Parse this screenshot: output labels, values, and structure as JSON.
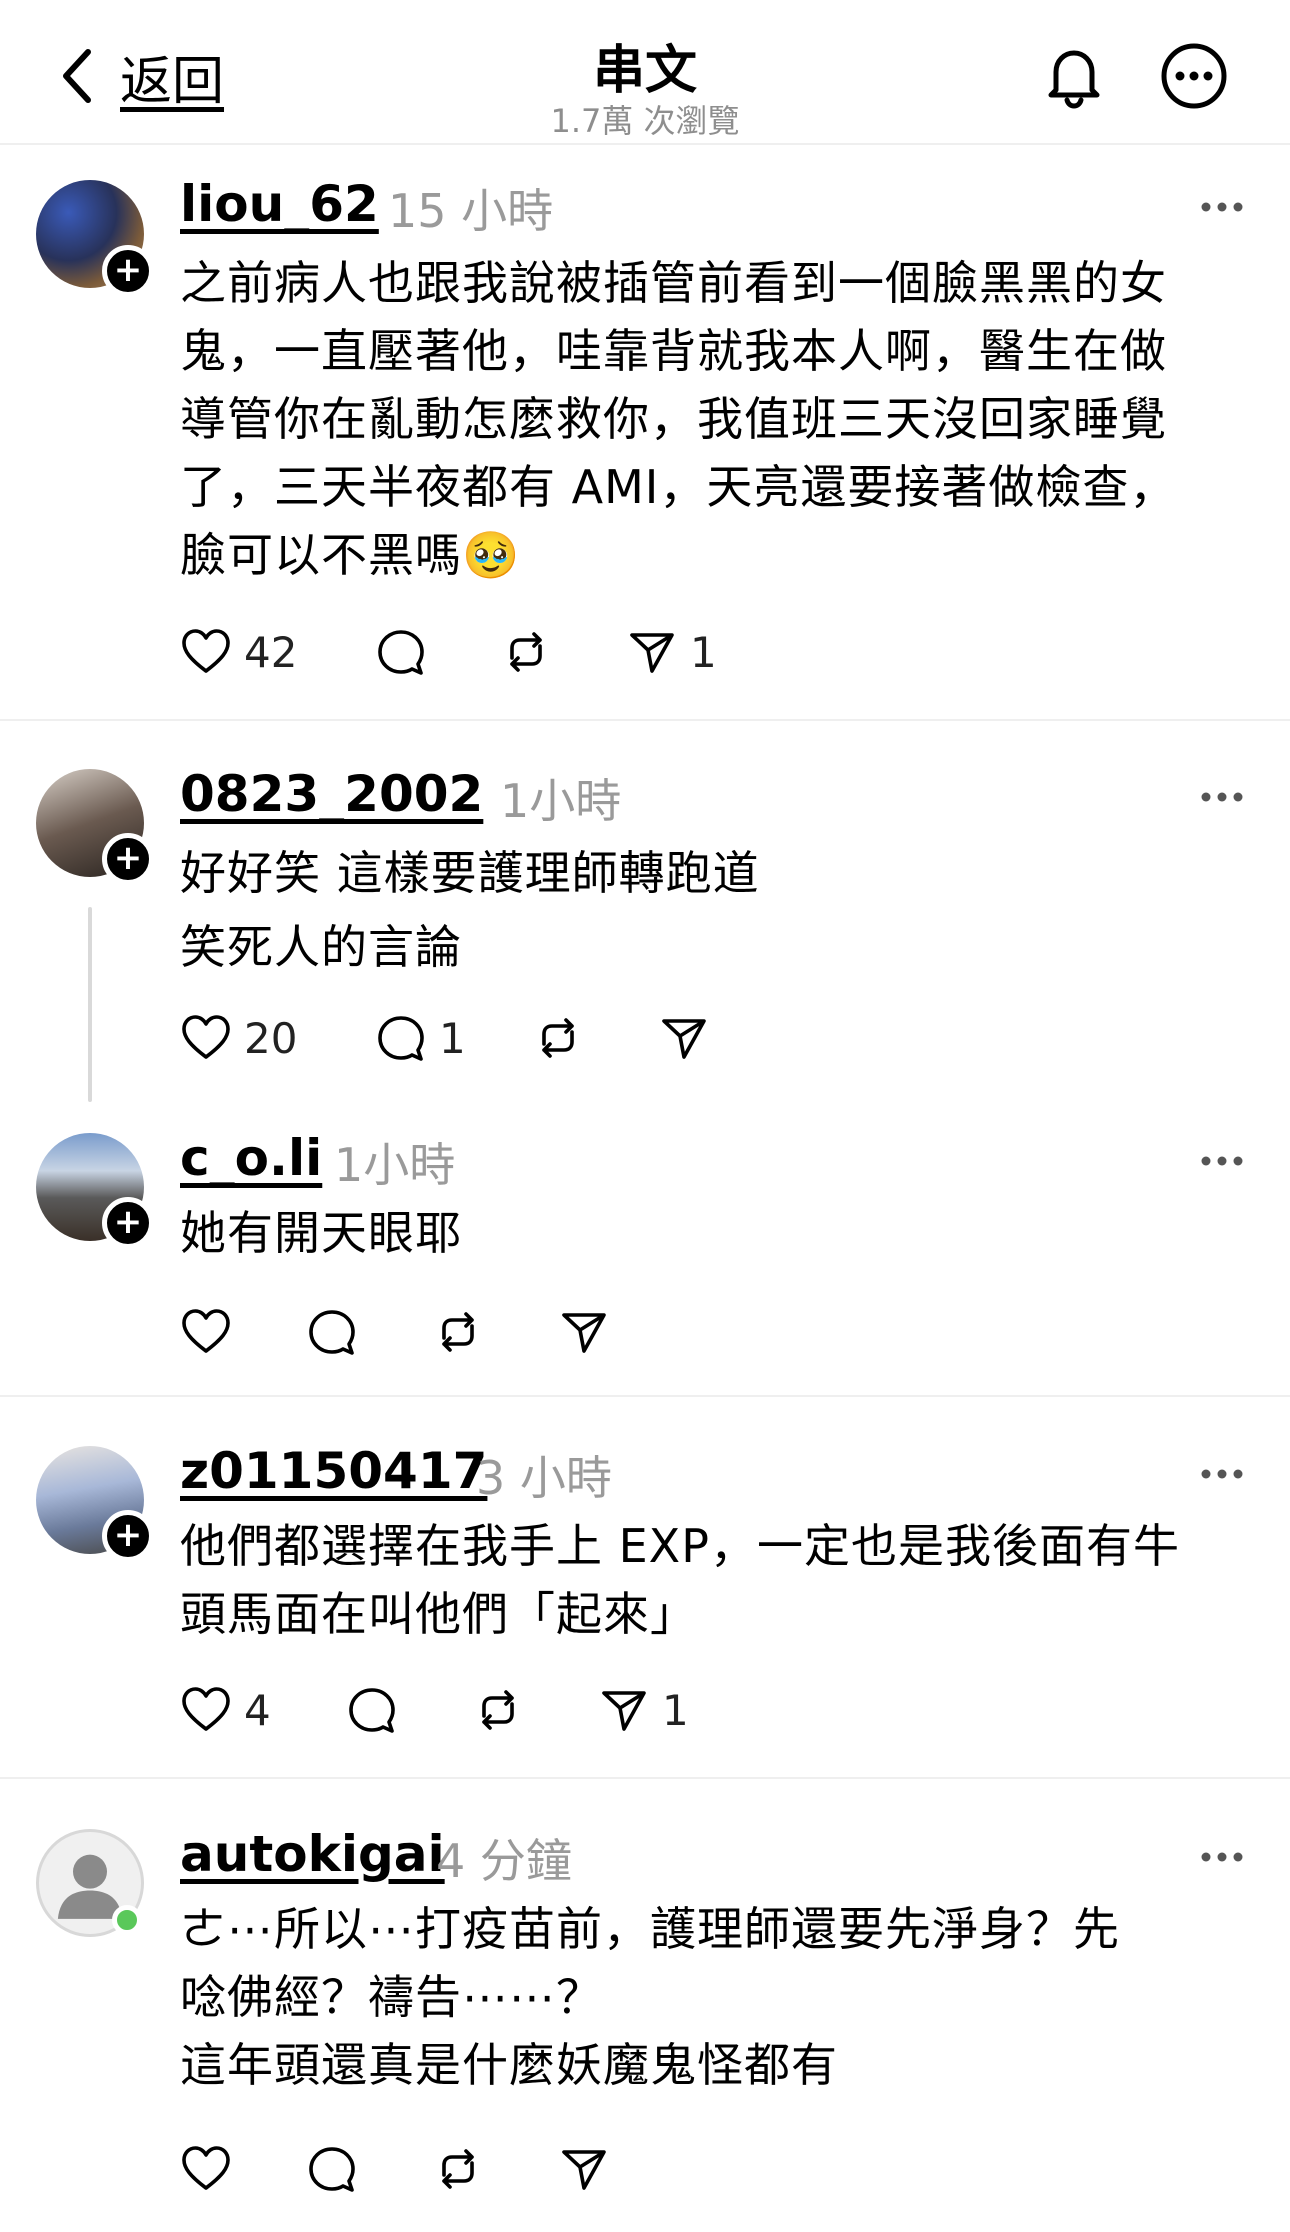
{
  "header": {
    "back_label": "返回",
    "title": "串文",
    "views": "1.7萬 次瀏覽"
  },
  "posts": [
    {
      "username": "liou_62",
      "time": "15 小時",
      "lines": [
        "之前病人也跟我說被插管前看到一個臉黑黑的女",
        "鬼，一直壓著他，哇靠背就我本人啊，醫生在做",
        "導管你在亂動怎麼救你，我值班三天沒回家睡覺",
        "了，三天半夜都有 AMI，天亮還要接著做檢查，",
        "臉可以不黑嗎🥹"
      ],
      "likes": "42",
      "comments": "",
      "reposts": "",
      "shares": "1"
    },
    {
      "username": "0823_2002",
      "time": "1小時",
      "lines": [
        "好好笑 這樣要護理師轉跑道",
        "笑死人的言論"
      ],
      "likes": "20",
      "comments": "1",
      "reposts": "",
      "shares": ""
    },
    {
      "username": "c_o.li",
      "time": "1小時",
      "lines": [
        "她有開天眼耶"
      ],
      "likes": "",
      "comments": "",
      "reposts": "",
      "shares": ""
    },
    {
      "username": "z01150417",
      "time": "3 小時",
      "lines": [
        "他們都選擇在我手上 EXP，一定也是我後面有牛",
        "頭馬面在叫他們「起來」"
      ],
      "likes": "4",
      "comments": "",
      "reposts": "",
      "shares": "1"
    },
    {
      "username": "autokigai",
      "time": "4 分鐘",
      "lines": [
        "ㄜ⋯所以⋯打疫苗前，護理師還要先淨身？先",
        "唸佛經？禱告⋯⋯？",
        "這年頭還真是什麼妖魔鬼怪都有"
      ],
      "likes": "",
      "comments": "",
      "reposts": "",
      "shares": ""
    }
  ],
  "icons": {
    "back": "chevron-left-icon",
    "bell": "bell-icon",
    "more": "more-circle-icon",
    "like": "heart-icon",
    "comment": "comment-bubble-icon",
    "repost": "repost-icon",
    "share": "send-icon",
    "options": "ellipsis-icon",
    "follow": "plus-icon"
  },
  "colors": {
    "muted": "#9a9a9a",
    "divider": "#efefef",
    "online": "#5ac85a"
  }
}
